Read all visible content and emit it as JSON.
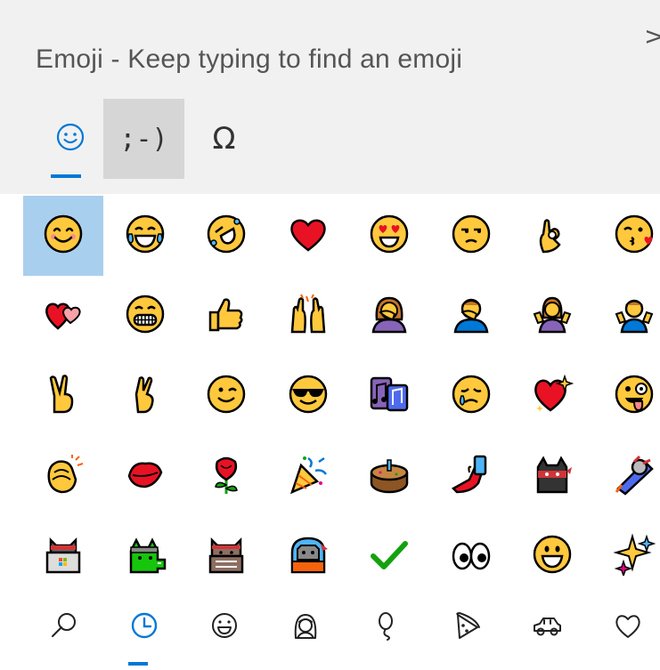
{
  "header": {
    "search_placeholder": "Emoji - Keep typing to find an emoji",
    "close_glyph": ">"
  },
  "tabs": [
    {
      "name": "emoji",
      "icon": "smiley-outline-icon",
      "active": true
    },
    {
      "name": "kaomoji",
      "label": ";-)",
      "active": false
    },
    {
      "name": "symbols",
      "label": "Ω",
      "active": false
    }
  ],
  "accent_color": "#0078d7",
  "selection_color": "#a9cfee",
  "grid": {
    "rows": [
      [
        "smiling-face-icon",
        "tears-of-joy-icon",
        "rolling-laughing-icon",
        "red-heart-icon",
        "heart-eyes-icon",
        "unamused-face-icon",
        "ok-hand-icon",
        "kissing-heart-icon"
      ],
      [
        "two-hearts-icon",
        "grimacing-face-icon",
        "thumbs-up-icon",
        "raising-hands-icon",
        "woman-facepalming-icon",
        "man-facepalming-icon",
        "woman-shrugging-icon",
        "man-shrugging-icon"
      ],
      [
        "victory-hand-icon",
        "crossed-fingers-icon",
        "winking-face-icon",
        "sunglasses-face-icon",
        "musical-notes-icon",
        "crying-face-icon",
        "sparkling-heart-icon",
        "zany-face-icon"
      ],
      [
        "clapping-hands-icon",
        "kiss-mark-icon",
        "rose-icon",
        "party-popper-icon",
        "birthday-cake-icon",
        "selfie-icon",
        "ninja-cat-icon",
        "astro-cat-icon"
      ],
      [
        "hacker-cat-icon",
        "dino-cat-icon",
        "stack-cat-icon",
        "hipster-cat-icon",
        "check-mark-icon",
        "eyes-icon",
        "grinning-face-icon",
        "sparkles-icon"
      ]
    ],
    "selected_index": 0
  },
  "bottom_categories": [
    {
      "icon": "search-icon",
      "active": false
    },
    {
      "icon": "recent-clock-icon",
      "active": true
    },
    {
      "icon": "smileys-icon",
      "active": false
    },
    {
      "icon": "people-icon",
      "active": false
    },
    {
      "icon": "balloon-icon",
      "active": false
    },
    {
      "icon": "food-pizza-icon",
      "active": false
    },
    {
      "icon": "travel-car-icon",
      "active": false
    },
    {
      "icon": "heart-outline-icon",
      "active": false
    }
  ]
}
